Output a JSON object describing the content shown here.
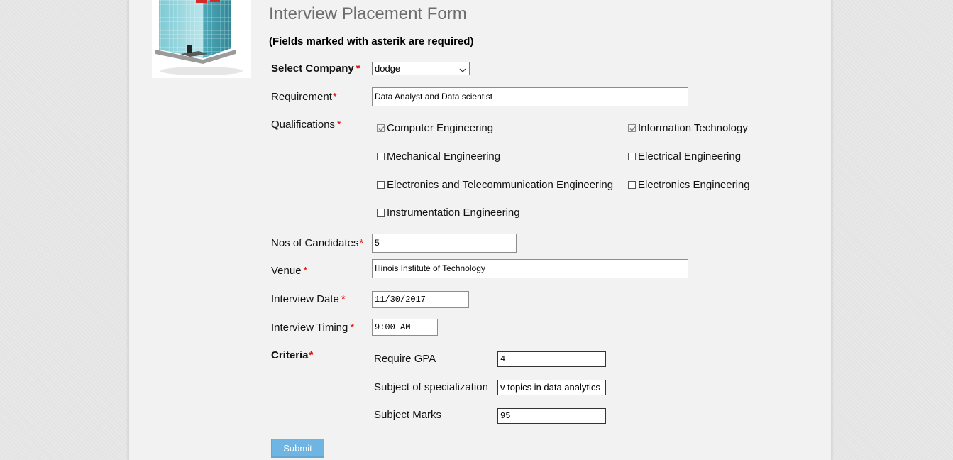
{
  "form": {
    "title": "Interview Placement Form",
    "subtitle": "(Fields marked with asterik are required)",
    "required_mark": "*",
    "company": {
      "label": "Select Company",
      "value": "dodge"
    },
    "requirement": {
      "label": "Requirement",
      "value": "Data Analyst and Data scientist"
    },
    "qualifications": {
      "label": "Qualifications",
      "options": [
        {
          "label": "Computer Engineering",
          "checked": true
        },
        {
          "label": "Information Technology",
          "checked": true
        },
        {
          "label": "Mechanical Engineering",
          "checked": false
        },
        {
          "label": "Electrical Engineering",
          "checked": false
        },
        {
          "label": "Electronics and Telecommunication Engineering",
          "checked": false
        },
        {
          "label": "Electronics Engineering",
          "checked": false
        },
        {
          "label": "Instrumentation Engineering",
          "checked": false
        }
      ]
    },
    "candidates": {
      "label": "Nos of Candidates",
      "value": "5"
    },
    "venue": {
      "label": "Venue",
      "value": "Illinois Institute of Technology"
    },
    "interview_date": {
      "label": "Interview Date",
      "value": "11/30/2017"
    },
    "interview_timing": {
      "label": "Interview Timing",
      "value": "9:00 AM"
    },
    "criteria": {
      "label": "Criteria",
      "gpa": {
        "label": "Require GPA",
        "value": "4"
      },
      "specialization": {
        "label": "Subject of specialization",
        "value": "v topics in data analytics"
      },
      "marks": {
        "label": "Subject Marks",
        "value": "95"
      }
    },
    "submit_label": "Submit"
  },
  "icons": {
    "logo": "office-building-icon",
    "dropdown": "chevron-down-icon",
    "checkmark": "checkmark-icon"
  },
  "colors": {
    "required": "#e01010",
    "submit_button": "#6fb5e3",
    "title": "#6d6d6d"
  }
}
